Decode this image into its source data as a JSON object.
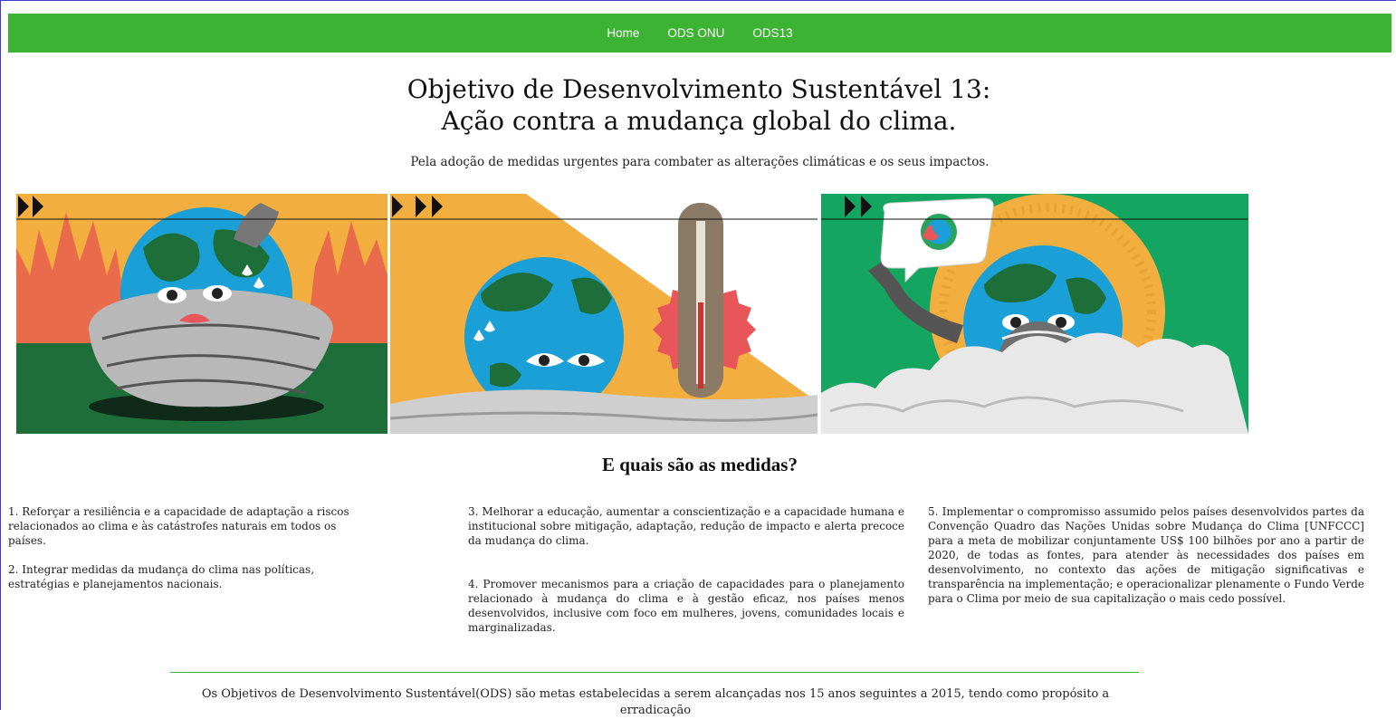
{
  "nav": {
    "items": [
      "Home",
      "ODS ONU",
      "ODS13"
    ]
  },
  "header": {
    "title_line1": "Objetivo de Desenvolvimento Sustentável 13:",
    "title_line2": "Ação contra a mudança global do clima.",
    "subtitle": "Pela adoção de medidas urgentes para combater as alterações climáticas e os seus impactos."
  },
  "images": [
    {
      "icon": "earth-wrapped-in-scarf-illustration"
    },
    {
      "icon": "earth-with-thermometer-illustration"
    },
    {
      "icon": "earth-with-mask-and-sign-illustration"
    }
  ],
  "measures": {
    "title": "E quais são as medidas?",
    "items": [
      "1. Reforçar a resiliência e a capacidade de adaptação a riscos relacionados ao clima e às catástrofes naturais em todos os países.",
      "2. Integrar medidas da mudança do clima nas políticas, estratégias e planejamentos nacionais.",
      "3. Melhorar a educação, aumentar a conscientização e a capacidade humana e institucional sobre mitigação, adaptação, redução de impacto e alerta precoce da mudança do clima.",
      "4. Promover mecanismos para a criação de capacidades para o planejamento relacionado à mudança do clima e à gestão eficaz, nos países menos desenvolvidos, inclusive com foco em mulheres, jovens, comunidades locais e marginalizadas.",
      "5. Implementar o compromisso assumido pelos países desenvolvidos partes da Convenção Quadro das Nações Unidas sobre Mudança do Clima [UNFCCC] para a meta de mobilizar conjuntamente US$ 100 bilhões por ano a partir de 2020, de todas as fontes, para atender às necessidades dos países em desenvolvimento, no contexto das ações de mitigação significativas e transparência na implementação; e operacionalizar plenamente o Fundo Verde para o Clima por meio de sua capitalização o mais cedo possível."
    ]
  },
  "footer": {
    "text": "Os Objetivos de Desenvolvimento Sustentável(ODS) são metas estabelecidas a serem alcançadas nos 15 anos seguintes a 2015, tendo como propósito a erradicação"
  },
  "colors": {
    "nav_bg": "#3cb332",
    "orange": "#f2ae3f",
    "blue": "#1a9fd6",
    "dark_green": "#1e6e3a",
    "coral": "#e9565a"
  }
}
